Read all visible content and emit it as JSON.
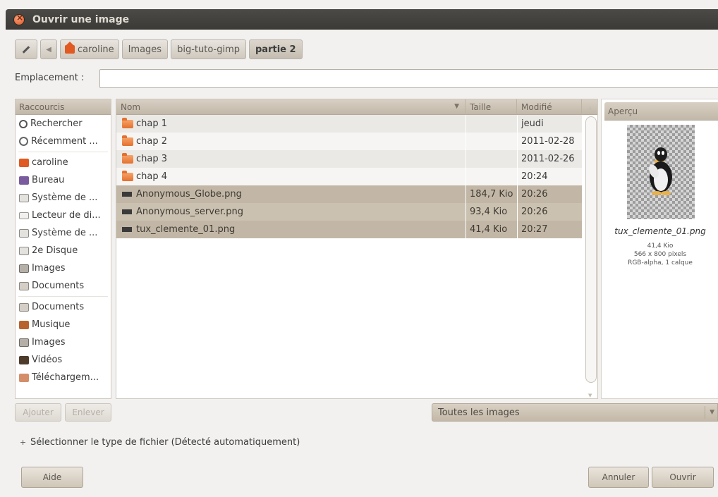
{
  "window": {
    "title": "Ouvrir une image"
  },
  "pathbar": {
    "crumbs": [
      "caroline",
      "Images",
      "big-tuto-gimp",
      "partie 2"
    ]
  },
  "location": {
    "label": "Emplacement :",
    "value": ""
  },
  "shortcuts": {
    "header": "Raccourcis",
    "items": [
      {
        "label": "Rechercher",
        "icon": "search-icon"
      },
      {
        "label": "Récemment ...",
        "icon": "clock-icon"
      },
      {
        "label": "caroline",
        "icon": "home-folder-icon"
      },
      {
        "label": "Bureau",
        "icon": "desktop-icon"
      },
      {
        "label": "Système de ...",
        "icon": "filesystem-icon"
      },
      {
        "label": "Lecteur de di...",
        "icon": "drive-icon"
      },
      {
        "label": "Système de ...",
        "icon": "filesystem-icon"
      },
      {
        "label": "2e Disque",
        "icon": "disk-icon"
      },
      {
        "label": "Images",
        "icon": "pictures-folder-icon"
      },
      {
        "label": "Documents",
        "icon": "documents-folder-icon"
      },
      {
        "label": "Documents",
        "icon": "documents-folder-icon"
      },
      {
        "label": "Musique",
        "icon": "music-folder-icon"
      },
      {
        "label": "Images",
        "icon": "pictures-folder-icon"
      },
      {
        "label": "Vidéos",
        "icon": "videos-folder-icon"
      },
      {
        "label": "Téléchargem...",
        "icon": "downloads-folder-icon"
      }
    ]
  },
  "files": {
    "columns": {
      "name": "Nom",
      "size": "Taille",
      "modified": "Modifié"
    },
    "rows": [
      {
        "name": "chap 1",
        "size": "",
        "modified": "jeudi",
        "type": "folder"
      },
      {
        "name": "chap 2",
        "size": "",
        "modified": "2011-02-28",
        "type": "folder"
      },
      {
        "name": "chap 3",
        "size": "",
        "modified": "2011-02-26",
        "type": "folder"
      },
      {
        "name": "chap 4",
        "size": "",
        "modified": "20:24",
        "type": "folder"
      },
      {
        "name": "Anonymous_Globe.png",
        "size": "184,7 Kio",
        "modified": "20:26",
        "type": "image"
      },
      {
        "name": "Anonymous_server.png",
        "size": "93,4 Kio",
        "modified": "20:26",
        "type": "image"
      },
      {
        "name": "tux_clemente_01.png",
        "size": "41,4 Kio",
        "modified": "20:27",
        "type": "image"
      }
    ]
  },
  "preview": {
    "header": "Aperçu",
    "filename": "tux_clemente_01.png",
    "size": "41,4 Kio",
    "dimensions": "566 x 800 pixels",
    "info": "RGB-alpha, 1 calque"
  },
  "buttons": {
    "add": "Ajouter",
    "remove": "Enlever",
    "help": "Aide",
    "cancel": "Annuler",
    "open": "Ouvrir"
  },
  "filter": {
    "selected": "Toutes les images"
  },
  "expander": {
    "label": "Sélectionner le type de fichier (Détecté automatiquement)"
  }
}
